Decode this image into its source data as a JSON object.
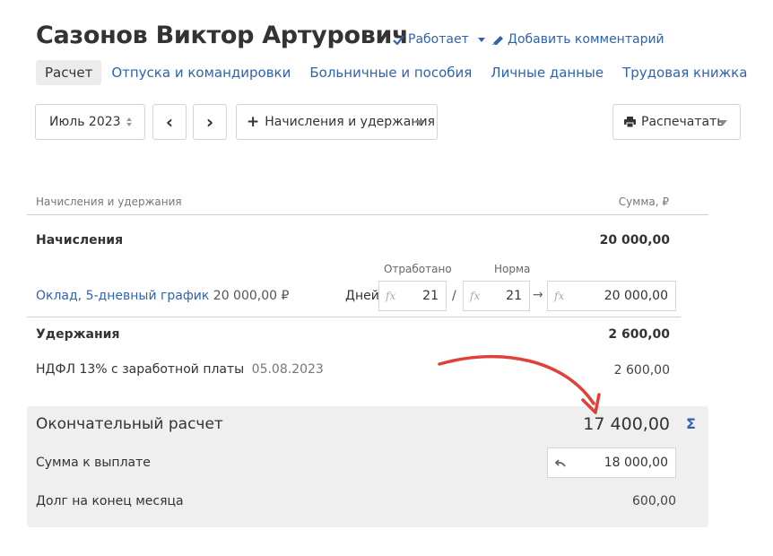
{
  "header": {
    "employee_name": "Сазонов Виктор Артурович",
    "status_label": "Работает",
    "comment_label": "Добавить комментарий"
  },
  "tabs": [
    {
      "label": "Расчет",
      "active": true
    },
    {
      "label": "Отпуска и командировки",
      "active": false
    },
    {
      "label": "Больничные и пособия",
      "active": false
    },
    {
      "label": "Личные данные",
      "active": false
    },
    {
      "label": "Трудовая книжка",
      "active": false
    }
  ],
  "toolbar": {
    "period": "Июль 2023",
    "prev_label": "‹",
    "next_label": "›",
    "add_label": "Начисления и удержания",
    "print_label": "Распечатать"
  },
  "table": {
    "col_name": "Начисления и удержания",
    "col_sum": "Сумма, ₽",
    "accruals": {
      "label": "Начисления",
      "sum": "20 000,00",
      "worked_label": "Отработано",
      "norm_label": "Норма",
      "item": {
        "name": "Оклад, 5-дневный график",
        "amount": "20 000,00 ₽",
        "unit": "Дней",
        "worked": "21",
        "divider": "/",
        "norm": "21",
        "arrow": "→",
        "result": "20 000,00"
      }
    },
    "deductions": {
      "label": "Удержания",
      "sum": "2 600,00",
      "item": {
        "name": "НДФЛ 13% с заработной платы",
        "date": "05.08.2023",
        "sum": "2 600,00"
      }
    }
  },
  "final": {
    "label": "Окончательный расчет",
    "total": "17 400,00",
    "sigma": "Σ",
    "pay_label": "Сумма к выплате",
    "pay_value": "18 000,00",
    "debt_label": "Долг на конец месяца",
    "debt_value": "600,00"
  },
  "colors": {
    "link": "#2f63b0",
    "annotation_arrow": "#e0403a",
    "final_bg": "#efefef"
  }
}
